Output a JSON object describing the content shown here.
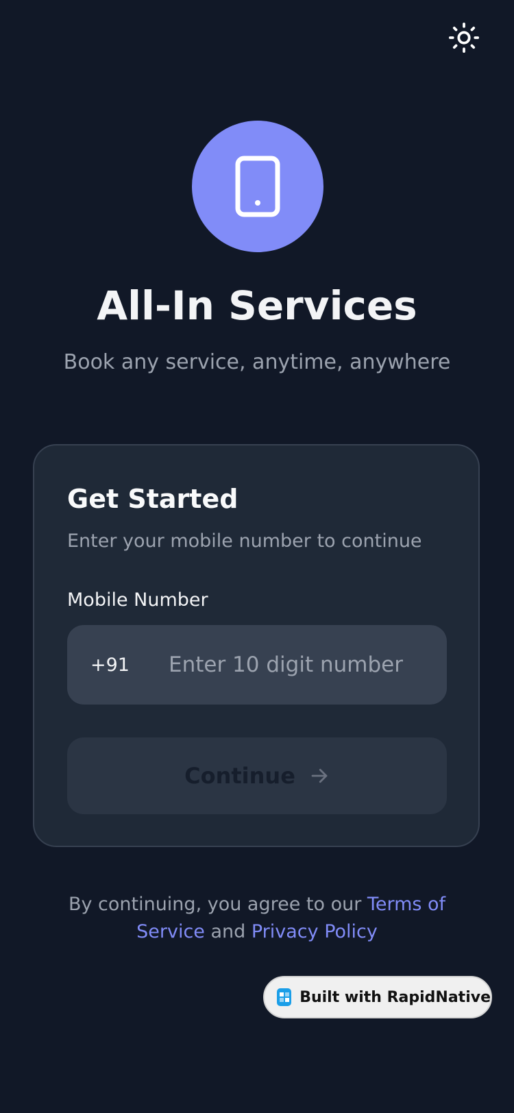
{
  "header": {
    "theme_toggle_icon": "sun-icon"
  },
  "hero": {
    "logo_icon": "smartphone-icon",
    "logo_color": "#818cf8",
    "title": "All-In Services",
    "subtitle": "Book any service, anytime, anywhere"
  },
  "login_card": {
    "title": "Get Started",
    "subtitle": "Enter your mobile number to continue",
    "mobile_label": "Mobile Number",
    "country_code": "+91",
    "phone_value": "",
    "phone_placeholder": "Enter 10 digit number",
    "continue_label": "Continue",
    "continue_icon": "arrow-right-icon"
  },
  "legal": {
    "prefix": "By continuing, you agree to our ",
    "terms_label": "Terms of Service",
    "joiner": " and ",
    "privacy_label": "Privacy Policy"
  },
  "badge": {
    "label": "Built with RapidNative",
    "icon": "rapidnative-logo-icon"
  },
  "colors": {
    "background": "#111827",
    "card": "#1f2937",
    "accent": "#818cf8",
    "muted_text": "#9ca3af"
  }
}
